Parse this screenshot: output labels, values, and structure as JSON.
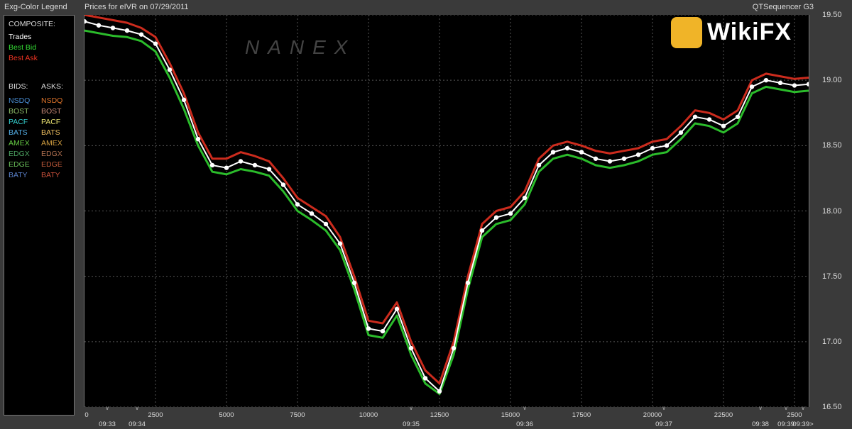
{
  "header": {
    "legend_title": "Exg-Color Legend",
    "chart_title": "Prices for  eIVR  on  07/29/2011",
    "app_name": "QTSequencer G3"
  },
  "legend": {
    "composite_label": "COMPOSITE:",
    "composite": [
      {
        "label": "Trades",
        "color": "#ffffff"
      },
      {
        "label": "Best Bid",
        "color": "#33dd33"
      },
      {
        "label": "Best Ask",
        "color": "#ee3322"
      }
    ],
    "bids_label": "BIDS:",
    "asks_label": "ASKS:",
    "exchanges": [
      {
        "bid": "NSDQ",
        "bid_color": "#4a8fd6",
        "ask": "NSDQ",
        "ask_color": "#e0742a"
      },
      {
        "bid": "BOST",
        "bid_color": "#8fbf6a",
        "ask": "BOST",
        "ask_color": "#c98a78"
      },
      {
        "bid": "PACF",
        "bid_color": "#33cccc",
        "ask": "PACF",
        "ask_color": "#e8e070"
      },
      {
        "bid": "BATS",
        "bid_color": "#55b0e8",
        "ask": "BATS",
        "ask_color": "#f0c060"
      },
      {
        "bid": "AMEX",
        "bid_color": "#66cc44",
        "ask": "AMEX",
        "ask_color": "#d4a040"
      },
      {
        "bid": "EDGX",
        "bid_color": "#4aa060",
        "ask": "EDGX",
        "ask_color": "#b07050"
      },
      {
        "bid": "EDGE",
        "bid_color": "#6abf5a",
        "ask": "EDGE",
        "ask_color": "#c05a3a"
      },
      {
        "bid": "BATY",
        "bid_color": "#5a80c8",
        "ask": "BATY",
        "ask_color": "#c8503a"
      }
    ]
  },
  "watermark": {
    "brand": "WikiFX",
    "faint": "NANEX"
  },
  "chart_data": {
    "type": "line",
    "symbol": "eIVR",
    "date": "07/29/2011",
    "xlim": [
      0,
      25500
    ],
    "ylim": [
      16.5,
      19.5
    ],
    "y_ticks": [
      "19.50",
      "19.00",
      "18.50",
      "18.00",
      "17.50",
      "17.00",
      "16.50"
    ],
    "y_tick_values": [
      19.5,
      19.0,
      18.5,
      18.0,
      17.5,
      17.0,
      16.5
    ],
    "x_ticks": [
      "0",
      "2500",
      "5000",
      "7500",
      "10000",
      "12500",
      "15000",
      "17500",
      "20000",
      "22500",
      "2500"
    ],
    "x_tick_values": [
      0,
      2500,
      5000,
      7500,
      10000,
      12500,
      15000,
      17500,
      20000,
      22500,
      25000
    ],
    "time_labels": [
      {
        "label": "09:33",
        "x": 800
      },
      {
        "label": "09:34",
        "x": 1850
      },
      {
        "label": "09:35",
        "x": 11500
      },
      {
        "label": "09:36",
        "x": 15500
      },
      {
        "label": "09:37",
        "x": 20400
      },
      {
        "label": "09:38",
        "x": 23800
      },
      {
        "label": "09:39",
        "x": 24700
      },
      {
        "label": "09:39>",
        "x": 25300
      }
    ],
    "series": [
      {
        "name": "Trades",
        "color": "#ffffff",
        "x": [
          0,
          500,
          1000,
          1500,
          2000,
          2500,
          3000,
          3500,
          4000,
          4500,
          5000,
          5500,
          6000,
          6500,
          7000,
          7500,
          8000,
          8500,
          9000,
          9500,
          10000,
          10500,
          11000,
          11500,
          12000,
          12500,
          13000,
          13500,
          14000,
          14500,
          15000,
          15500,
          16000,
          16500,
          17000,
          17500,
          18000,
          18500,
          19000,
          19500,
          20000,
          20500,
          21000,
          21500,
          22000,
          22500,
          23000,
          23500,
          24000,
          24500,
          25000,
          25500
        ],
        "values": [
          19.45,
          19.42,
          19.4,
          19.38,
          19.35,
          19.28,
          19.08,
          18.85,
          18.55,
          18.35,
          18.33,
          18.38,
          18.35,
          18.32,
          18.2,
          18.05,
          17.98,
          17.9,
          17.75,
          17.45,
          17.1,
          17.08,
          17.25,
          16.95,
          16.72,
          16.62,
          16.95,
          17.45,
          17.85,
          17.95,
          17.98,
          18.1,
          18.35,
          18.45,
          18.48,
          18.45,
          18.4,
          18.38,
          18.4,
          18.43,
          18.48,
          18.5,
          18.6,
          18.72,
          18.7,
          18.65,
          18.72,
          18.95,
          19.0,
          18.98,
          18.96,
          18.97
        ]
      },
      {
        "name": "Best Bid",
        "color": "#33dd33",
        "x": [
          0,
          500,
          1000,
          1500,
          2000,
          2500,
          3000,
          3500,
          4000,
          4500,
          5000,
          5500,
          6000,
          6500,
          7000,
          7500,
          8000,
          8500,
          9000,
          9500,
          10000,
          10500,
          11000,
          11500,
          12000,
          12500,
          13000,
          13500,
          14000,
          14500,
          15000,
          15500,
          16000,
          16500,
          17000,
          17500,
          18000,
          18500,
          19000,
          19500,
          20000,
          20500,
          21000,
          21500,
          22000,
          22500,
          23000,
          23500,
          24000,
          24500,
          25000,
          25500
        ],
        "values": [
          19.38,
          19.36,
          19.34,
          19.33,
          19.3,
          19.22,
          19.02,
          18.78,
          18.5,
          18.3,
          18.28,
          18.32,
          18.3,
          18.27,
          18.15,
          18.0,
          17.93,
          17.85,
          17.7,
          17.4,
          17.05,
          17.03,
          17.2,
          16.9,
          16.68,
          16.6,
          16.9,
          17.4,
          17.8,
          17.9,
          17.93,
          18.05,
          18.3,
          18.4,
          18.43,
          18.4,
          18.35,
          18.33,
          18.35,
          18.38,
          18.43,
          18.45,
          18.55,
          18.67,
          18.65,
          18.6,
          18.67,
          18.9,
          18.95,
          18.93,
          18.91,
          18.92
        ]
      },
      {
        "name": "Best Ask",
        "color": "#ee3322",
        "x": [
          0,
          500,
          1000,
          1500,
          2000,
          2500,
          3000,
          3500,
          4000,
          4500,
          5000,
          5500,
          6000,
          6500,
          7000,
          7500,
          8000,
          8500,
          9000,
          9500,
          10000,
          10500,
          11000,
          11500,
          12000,
          12500,
          13000,
          13500,
          14000,
          14500,
          15000,
          15500,
          16000,
          16500,
          17000,
          17500,
          18000,
          18500,
          19000,
          19500,
          20000,
          20500,
          21000,
          21500,
          22000,
          22500,
          23000,
          23500,
          24000,
          24500,
          25000,
          25500
        ],
        "values": [
          19.5,
          19.48,
          19.46,
          19.44,
          19.4,
          19.33,
          19.13,
          18.9,
          18.6,
          18.4,
          18.4,
          18.45,
          18.42,
          18.38,
          18.25,
          18.1,
          18.03,
          17.96,
          17.8,
          17.5,
          17.16,
          17.14,
          17.3,
          17.0,
          16.78,
          16.68,
          17.0,
          17.5,
          17.9,
          18.0,
          18.03,
          18.15,
          18.4,
          18.5,
          18.53,
          18.5,
          18.46,
          18.44,
          18.46,
          18.48,
          18.53,
          18.55,
          18.65,
          18.77,
          18.75,
          18.7,
          18.77,
          19.0,
          19.05,
          19.03,
          19.01,
          19.02
        ]
      }
    ],
    "grid": true,
    "legend": "left-panel"
  }
}
